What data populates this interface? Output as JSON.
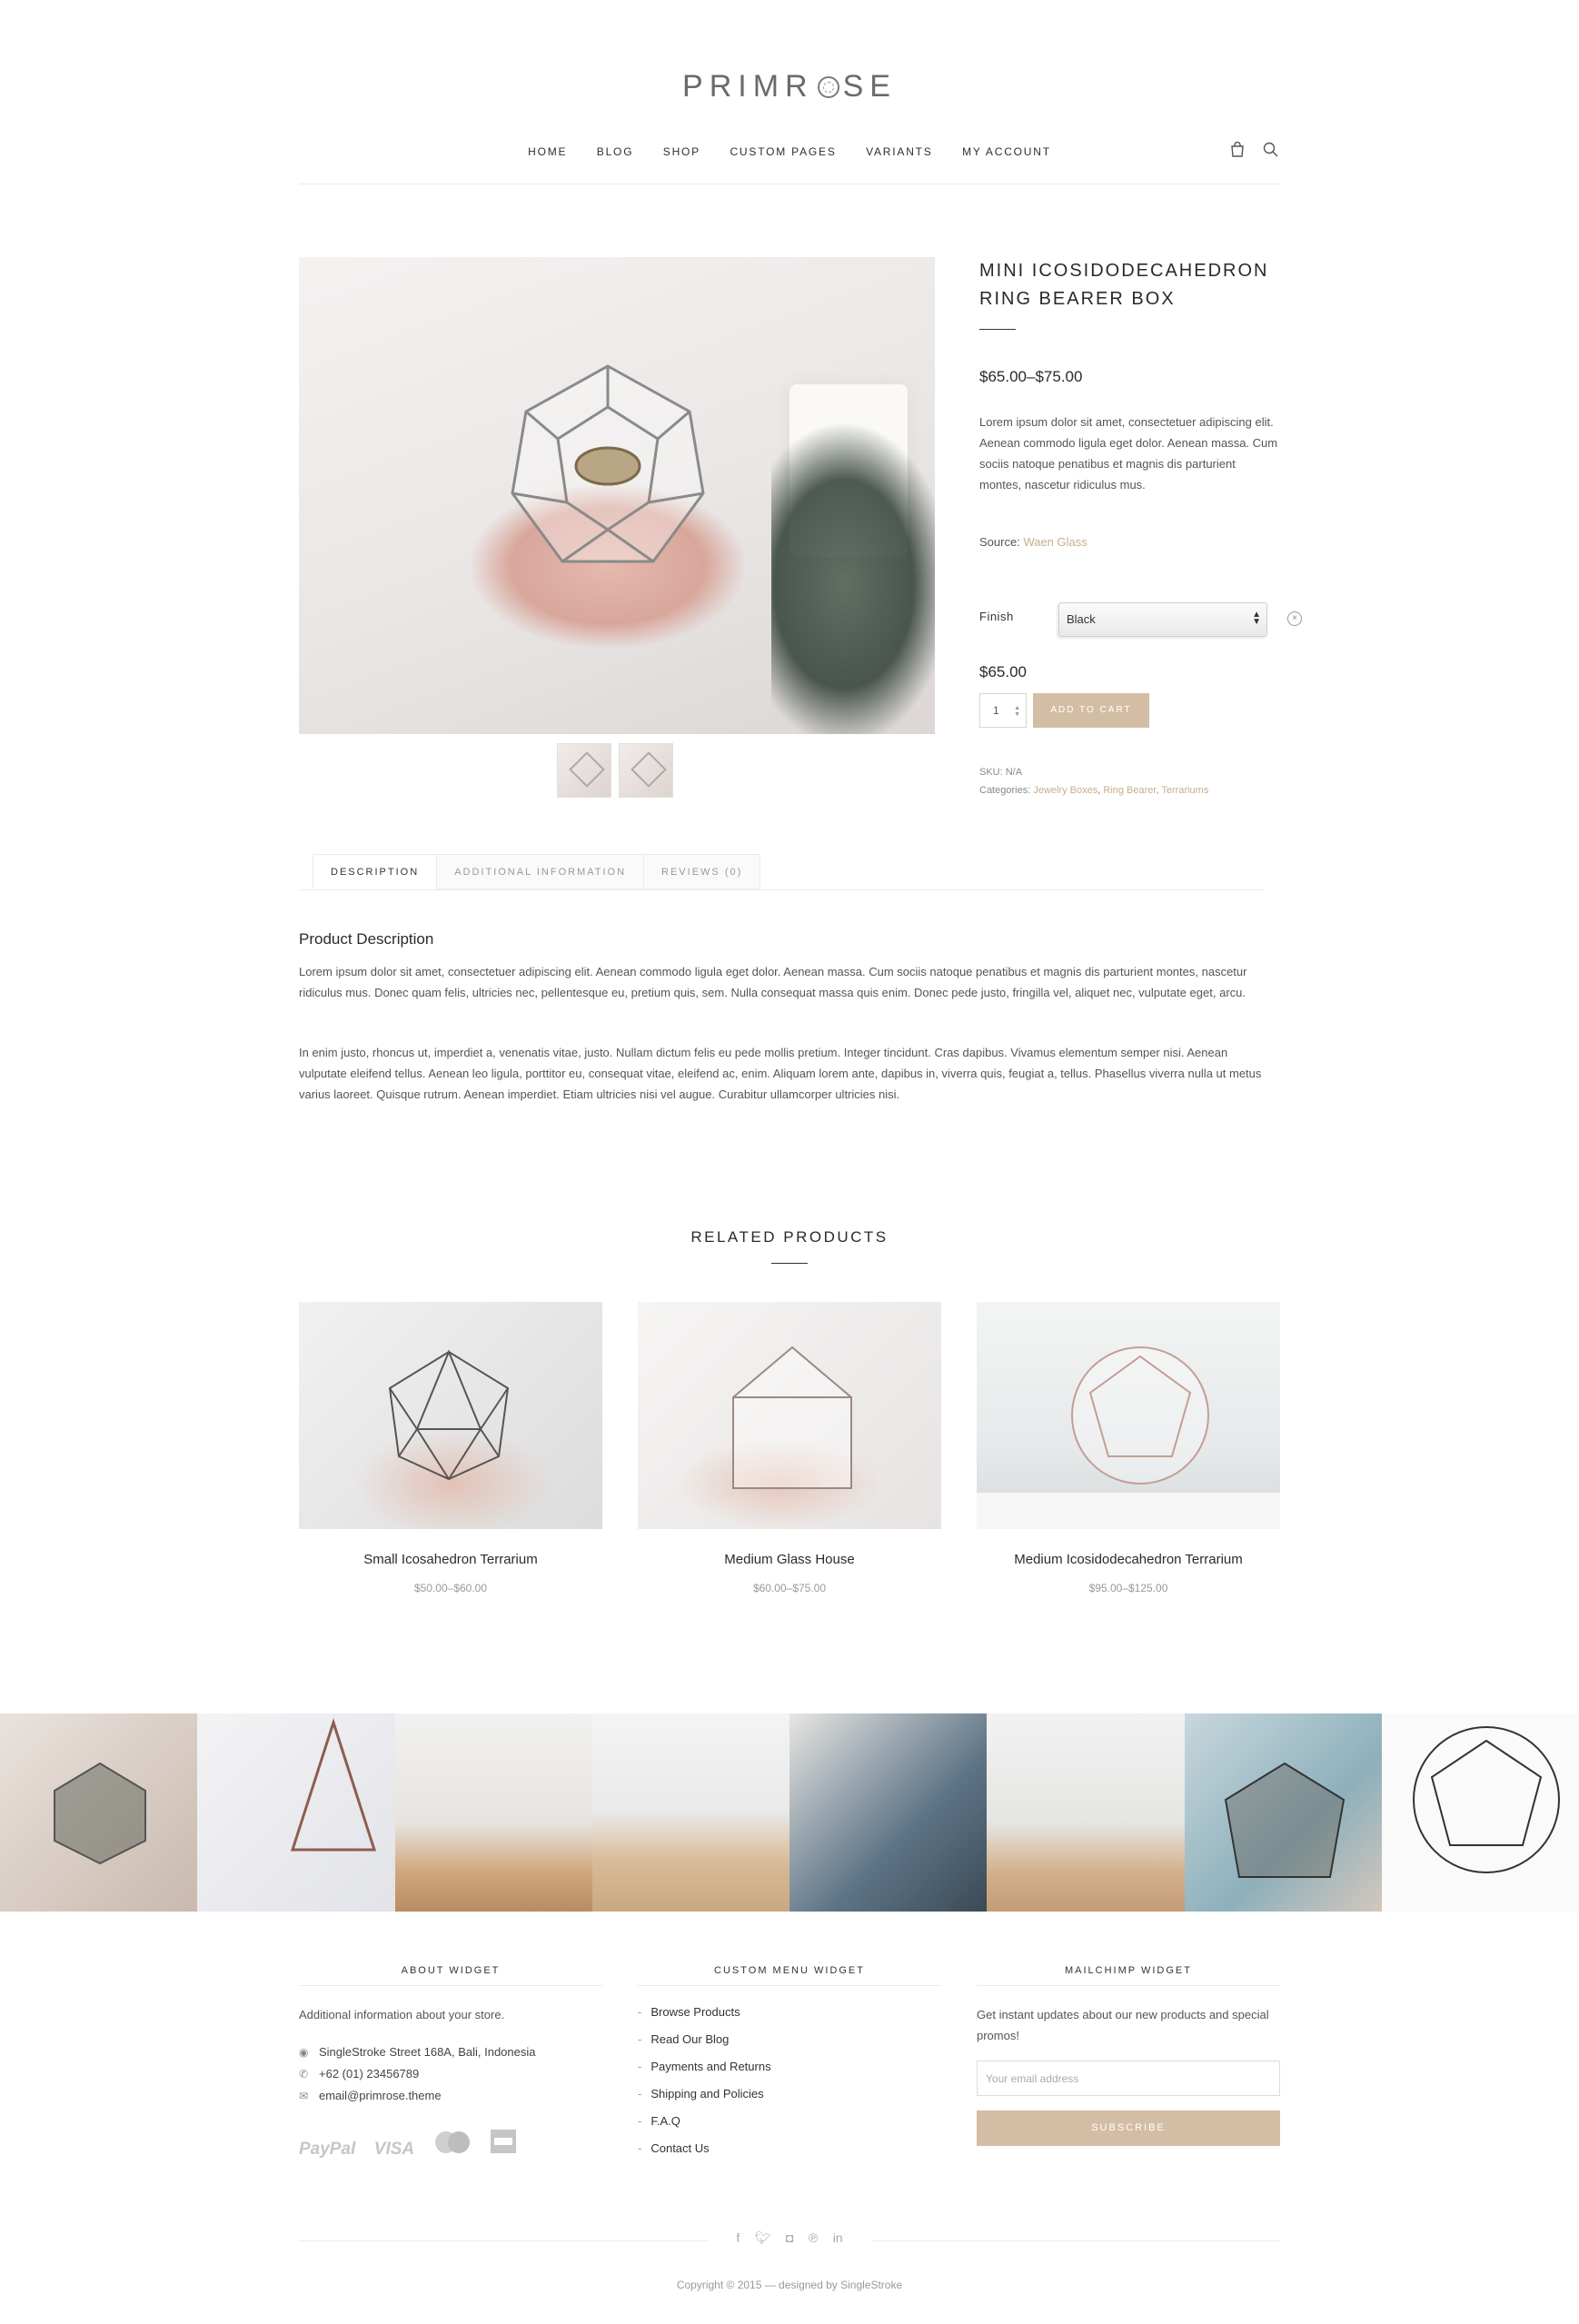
{
  "header": {
    "logo_left": "PRIMR",
    "logo_right": "SE",
    "nav": [
      "HOME",
      "BLOG",
      "SHOP",
      "CUSTOM PAGES",
      "VARIANTS",
      "MY ACCOUNT"
    ],
    "icons": [
      "bag-icon",
      "search-icon"
    ]
  },
  "product": {
    "title": "MINI ICOSIDODECAHEDRON RING BEARER BOX",
    "price_range": "$65.00–$75.00",
    "short_description": "Lorem ipsum dolor sit amet, consectetuer adipiscing elit. Aenean commodo ligula eget dolor. Aenean massa. Cum sociis natoque penatibus et magnis dis parturient montes, nascetur ridiculus mus.",
    "source_label": "Source:",
    "source_link": "Waen Glass",
    "finish_label": "Finish",
    "finish_value": "Black",
    "variation_price": "$65.00",
    "quantity": "1",
    "add_to_cart": "ADD TO CART",
    "sku": "SKU: N/A",
    "categories_label": "Categories:",
    "categories": [
      "Jewelry Boxes",
      "Ring Bearer",
      "Terrariums"
    ]
  },
  "tabs": {
    "items": [
      "DESCRIPTION",
      "ADDITIONAL INFORMATION",
      "REVIEWS (0)"
    ],
    "active": "DESCRIPTION",
    "heading": "Product Description",
    "paragraph1": "Lorem ipsum dolor sit amet, consectetuer adipiscing elit. Aenean commodo ligula eget dolor. Aenean massa. Cum sociis natoque penatibus et magnis dis parturient montes, nascetur ridiculus mus. Donec quam felis, ultricies nec, pellentesque eu, pretium quis, sem. Nulla consequat massa quis enim. Donec pede justo, fringilla vel, aliquet nec, vulputate eget, arcu.",
    "paragraph2": "In enim justo, rhoncus ut, imperdiet a, venenatis vitae, justo. Nullam dictum felis eu pede mollis pretium. Integer tincidunt. Cras dapibus. Vivamus elementum semper nisi. Aenean vulputate eleifend tellus. Aenean leo ligula, porttitor eu, consequat vitae, eleifend ac, enim. Aliquam lorem ante, dapibus in, viverra quis, feugiat a, tellus. Phasellus viverra nulla ut metus varius laoreet. Quisque rutrum. Aenean imperdiet. Etiam ultricies nisi vel augue. Curabitur ullamcorper ultricies nisi."
  },
  "related": {
    "heading": "RELATED PRODUCTS",
    "items": [
      {
        "name": "Small Icosahedron Terrarium",
        "price": "$50.00–$60.00"
      },
      {
        "name": "Medium Glass House",
        "price": "$60.00–$75.00"
      },
      {
        "name": "Medium Icosidodecahedron Terrarium",
        "price": "$95.00–$125.00"
      }
    ]
  },
  "footer": {
    "about": {
      "heading": "ABOUT WIDGET",
      "text": "Additional information about your store.",
      "address": "SingleStroke Street 168A, Bali, Indonesia",
      "phone": "+62 (01) 23456789",
      "email": "email@primrose.theme",
      "payments": [
        "PayPal",
        "VISA",
        "mastercard",
        "amex"
      ]
    },
    "menu": {
      "heading": "CUSTOM MENU WIDGET",
      "items": [
        "Browse Products",
        "Read Our Blog",
        "Payments and Returns",
        "Shipping and Policies",
        "F.A.Q",
        "Contact Us"
      ]
    },
    "mailchimp": {
      "heading": "MAILCHIMP WIDGET",
      "text": "Get instant updates about our new products and special promos!",
      "placeholder": "Your email address",
      "button": "SUBSCRIBE"
    },
    "social": [
      "facebook-icon",
      "twitter-icon",
      "instagram-icon",
      "pinterest-icon",
      "linkedin-icon"
    ],
    "copyright": "Copyright © 2015 — designed by SingleStroke"
  },
  "colors": {
    "accent": "#d3bea5",
    "link": "#c9ac8f"
  }
}
